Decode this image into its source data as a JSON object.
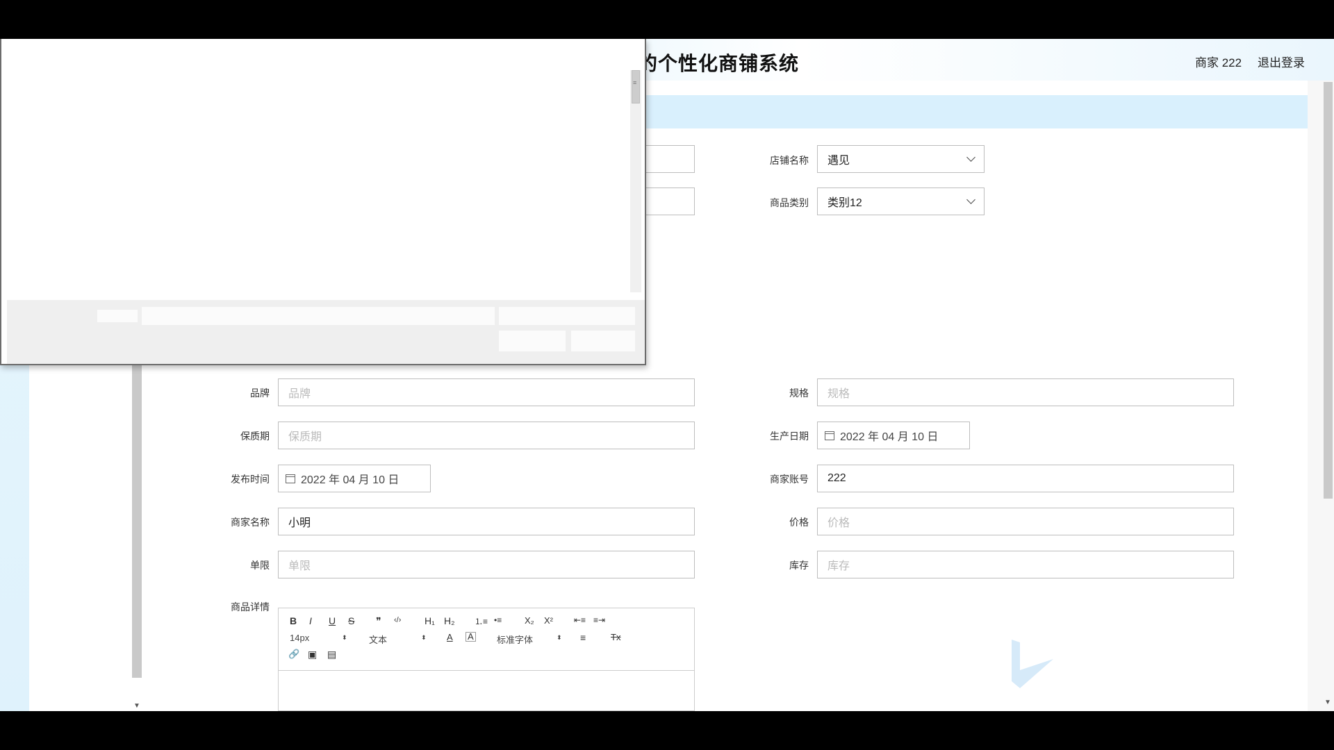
{
  "header": {
    "site_title": "的个性化商铺系统",
    "user_label": "商家 222",
    "logout_label": "退出登录"
  },
  "form": {
    "shop_name": {
      "label": "店铺名称",
      "value": "遇见"
    },
    "category": {
      "label": "商品类别",
      "value": "类别12"
    },
    "brand": {
      "label": "品牌",
      "placeholder": "品牌"
    },
    "spec": {
      "label": "规格",
      "placeholder": "规格"
    },
    "shelf_life": {
      "label": "保质期",
      "placeholder": "保质期"
    },
    "production_date": {
      "label": "生产日期",
      "value": "2022 年 04 月 10 日"
    },
    "publish_time": {
      "label": "发布时间",
      "value": "2022 年 04 月 10 日"
    },
    "merchant_account": {
      "label": "商家账号",
      "value": "222"
    },
    "merchant_name": {
      "label": "商家名称",
      "value": "小明"
    },
    "price": {
      "label": "价格",
      "placeholder": "价格"
    },
    "limit": {
      "label": "单限",
      "placeholder": "单限"
    },
    "stock": {
      "label": "库存",
      "placeholder": "库存"
    },
    "details": {
      "label": "商品详情"
    }
  },
  "editor": {
    "bold": "B",
    "italic": "I",
    "underline": "U",
    "strike": "S",
    "quote": "❞",
    "code": "‹/›",
    "h1": "H₁",
    "h2": "H₂",
    "ordered_list": "⒈≡",
    "bullet_list": "•≡",
    "subscript": "X₂",
    "superscript": "X²",
    "outdent": "⇤≡",
    "indent": "≡⇥",
    "font_size": "14px",
    "text_style": "文本",
    "font_family": "标准字体",
    "color": "A",
    "background": "A",
    "align": "≡",
    "clear": "Tx",
    "link": "🔗",
    "image": "▣",
    "video": "▤"
  }
}
